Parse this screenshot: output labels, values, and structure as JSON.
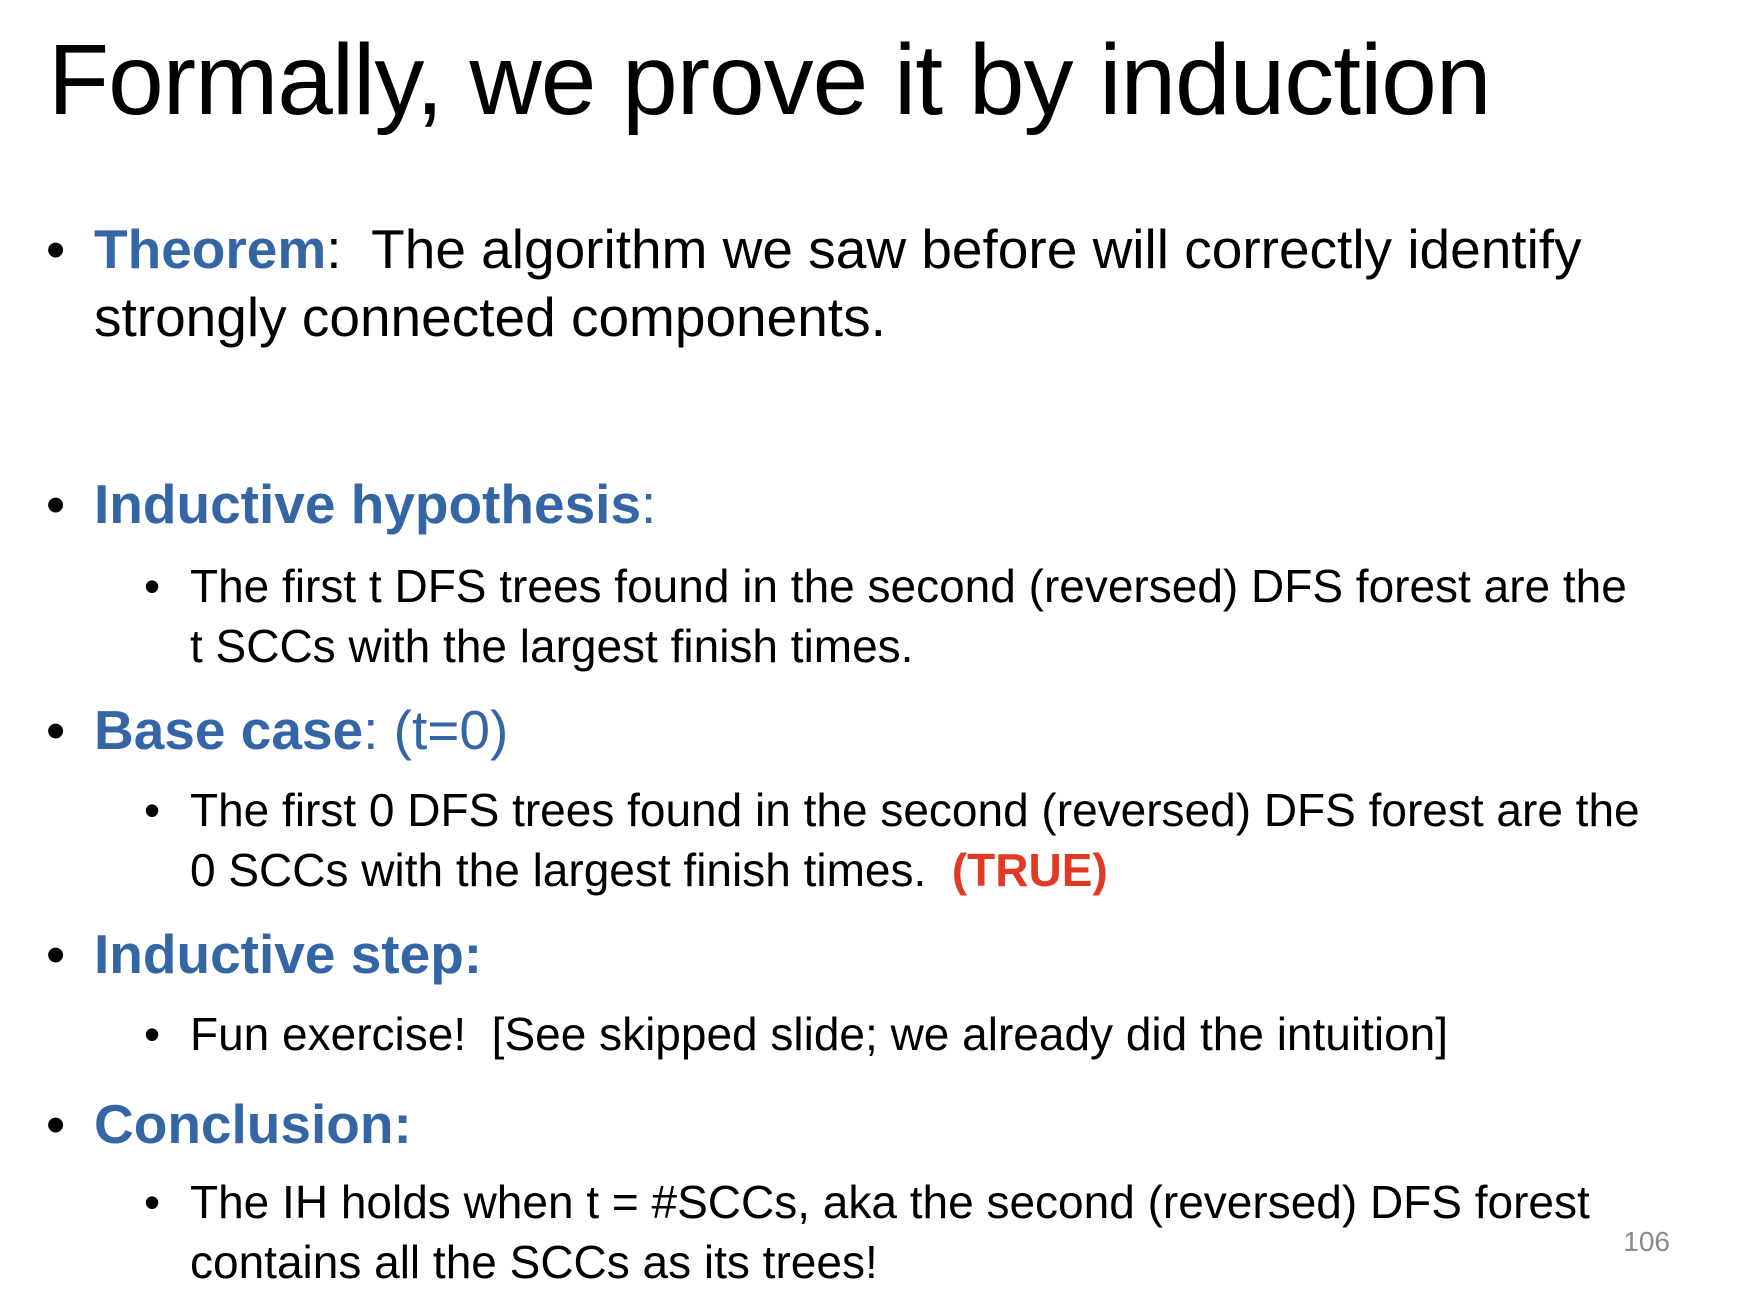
{
  "slide": {
    "title": "Formally, we prove it by induction",
    "theorem": {
      "label": "Theorem",
      "sep": ":",
      "text": "  The algorithm we saw before will correctly identify strongly connected components."
    },
    "hypothesis": {
      "label": "Inductive hypothesis",
      "sep": ":",
      "sub": "The first t DFS trees found in the second (reversed) DFS forest are the t SCCs with the largest finish times."
    },
    "base_case": {
      "label": "Base case",
      "rest": ": (t=0)",
      "sub": "The first 0 DFS trees found in the second (reversed) DFS forest are the 0 SCCs with the largest finish times.  ",
      "sub_tag": "(TRUE)"
    },
    "step": {
      "label": "Inductive step:",
      "sub": "Fun exercise!  [See skipped slide; we already did the intuition]"
    },
    "conclusion": {
      "label": "Conclusion:",
      "sub": "The IH holds when t = #SCCs, aka the second (reversed) DFS forest contains all the SCCs as its trees!"
    },
    "bullet": "•",
    "page_number": "106"
  }
}
